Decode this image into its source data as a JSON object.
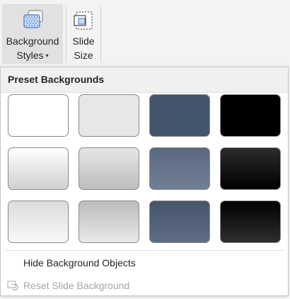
{
  "ribbon": {
    "background_styles": {
      "line1": "Background",
      "line2": "Styles",
      "icon": "background-styles-icon",
      "caret": "▾"
    },
    "slide_size": {
      "line1": "Slide",
      "line2": "Size",
      "icon": "slide-size-icon"
    }
  },
  "dropdown": {
    "header": "Preset Backgrounds",
    "swatches": [
      {
        "style": "Style 1",
        "fill": "#ffffff"
      },
      {
        "style": "Style 2",
        "fill": "#e7e7e7"
      },
      {
        "style": "Style 3",
        "fill": "#44546a"
      },
      {
        "style": "Style 4",
        "fill": "#000000"
      },
      {
        "style": "Style 5",
        "fill": "linear-gradient(#ffffff,#d0d0d0)"
      },
      {
        "style": "Style 6",
        "fill": "linear-gradient(#e6e6e6,#bdbdbd)"
      },
      {
        "style": "Style 7",
        "fill": "linear-gradient(#5a6780,#717f95)"
      },
      {
        "style": "Style 8",
        "fill": "linear-gradient(#2b2b2b,#000000)"
      },
      {
        "style": "Style 9",
        "fill": "linear-gradient(#dcdcdc,#f8f8f8)"
      },
      {
        "style": "Style 10",
        "fill": "linear-gradient(#bcbcbc,#e8e8e8)"
      },
      {
        "style": "Style 11",
        "fill": "linear-gradient(#44546a,#5f6d84)"
      },
      {
        "style": "Style 12",
        "fill": "linear-gradient(#000000,#2e2e2e)"
      }
    ],
    "menu": {
      "hide_background_objects": "Hide Background Objects",
      "reset_slide_background": "Reset Slide Background",
      "reset_icon": "reset-slide-background-icon"
    }
  },
  "colors": {
    "accent": "#4472c4",
    "selected_ribbon_button": "#e1e1e1",
    "disabled_text": "#a6a6a6"
  }
}
